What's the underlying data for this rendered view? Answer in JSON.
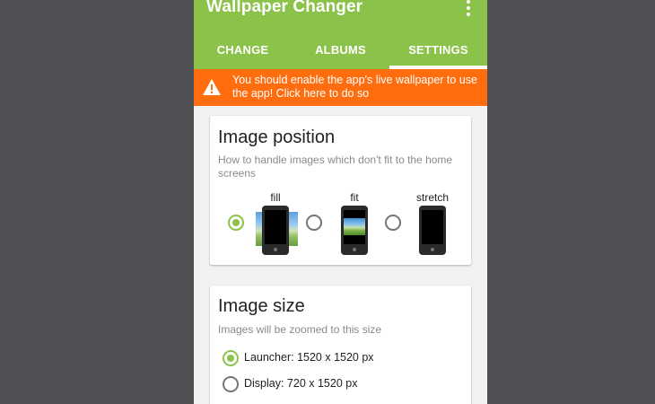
{
  "app": {
    "title": "Wallpaper Changer"
  },
  "tabs": [
    {
      "label": "CHANGE",
      "selected": false
    },
    {
      "label": "ALBUMS",
      "selected": false
    },
    {
      "label": "SETTINGS",
      "selected": true
    }
  ],
  "banner": {
    "text": "You should enable the app's live wallpaper to use the app! Click here to do so",
    "icon": "warning-icon"
  },
  "image_position": {
    "title": "Image position",
    "description": "How to handle images which don't fit to the home screens",
    "options": [
      {
        "label": "fill",
        "selected": true
      },
      {
        "label": "fit",
        "selected": false
      },
      {
        "label": "stretch",
        "selected": false
      }
    ]
  },
  "image_size": {
    "title": "Image size",
    "description": "Images will be zoomed to this size",
    "options": [
      {
        "label": "Launcher: 1520 x 1520 px",
        "selected": true
      },
      {
        "label": "Display: 720 x 1520 px",
        "selected": false
      }
    ]
  },
  "colors": {
    "primary": "#8bc34a",
    "warning": "#ff6d0f",
    "background": "#505154"
  }
}
